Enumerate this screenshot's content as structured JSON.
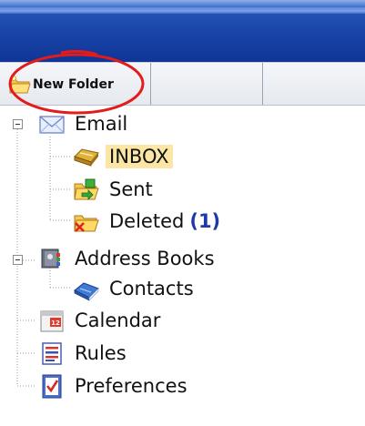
{
  "toolbar": {
    "new_folder_label": "New Folder"
  },
  "tree": {
    "email": {
      "label": "Email",
      "icon": "envelope-icon",
      "children": {
        "inbox": {
          "label": "INBOX",
          "icon": "inbox-tray-icon",
          "selected": true
        },
        "sent": {
          "label": "Sent",
          "icon": "sent-folder-icon"
        },
        "deleted": {
          "label": "Deleted",
          "count": "(1)",
          "icon": "deleted-folder-icon"
        }
      }
    },
    "address_books": {
      "label": "Address Books",
      "icon": "address-book-icon",
      "children": {
        "contacts": {
          "label": "Contacts",
          "icon": "contacts-book-icon"
        }
      }
    },
    "calendar": {
      "label": "Calendar",
      "icon": "calendar-icon"
    },
    "rules": {
      "label": "Rules",
      "icon": "rules-icon"
    },
    "preferences": {
      "label": "Preferences",
      "icon": "preferences-icon"
    }
  },
  "colors": {
    "header_blue": "#1c49ad",
    "selection_bg": "#fbe6a6",
    "count_text": "#1d3aa8",
    "annotation_ring": "#e21b1b"
  }
}
